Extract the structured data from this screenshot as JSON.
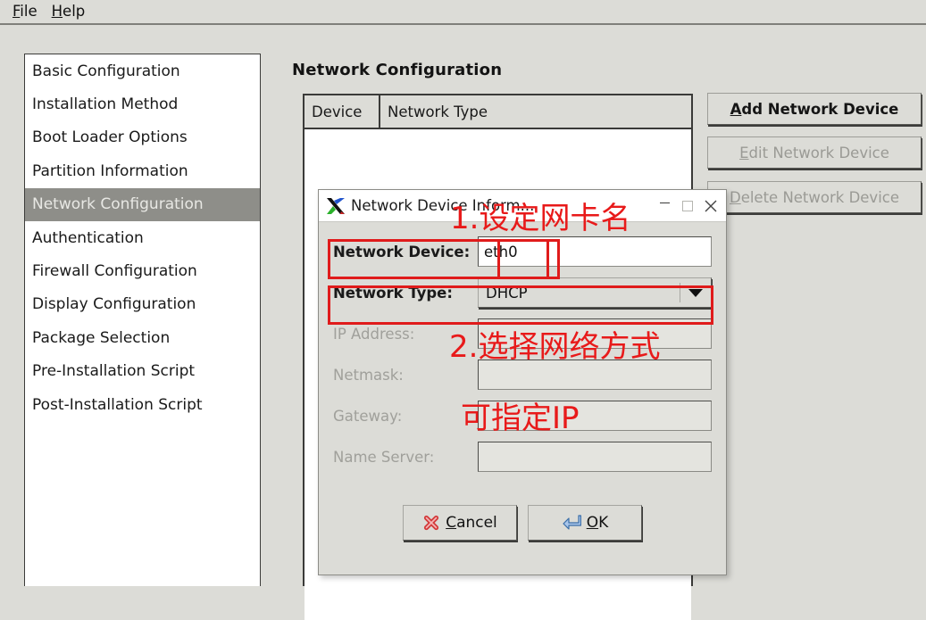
{
  "menubar": {
    "items": [
      {
        "name": "file",
        "accel": "F",
        "rest": "ile"
      },
      {
        "name": "help",
        "accel": "H",
        "rest": "elp"
      }
    ]
  },
  "sidebar": {
    "items": [
      {
        "label": "Basic Configuration",
        "selected": false
      },
      {
        "label": "Installation Method",
        "selected": false
      },
      {
        "label": "Boot Loader Options",
        "selected": false
      },
      {
        "label": "Partition Information",
        "selected": false
      },
      {
        "label": "Network Configuration",
        "selected": true
      },
      {
        "label": "Authentication",
        "selected": false
      },
      {
        "label": "Firewall Configuration",
        "selected": false
      },
      {
        "label": "Display Configuration",
        "selected": false
      },
      {
        "label": "Package Selection",
        "selected": false
      },
      {
        "label": "Pre-Installation Script",
        "selected": false
      },
      {
        "label": "Post-Installation Script",
        "selected": false
      }
    ]
  },
  "main": {
    "title": "Network Configuration",
    "table": {
      "columns": [
        "Device",
        "Network Type"
      ],
      "rows": []
    },
    "buttons": [
      {
        "key": "add",
        "accel": "A",
        "rest": "dd Network Device",
        "enabled": true
      },
      {
        "key": "edit",
        "accel": "E",
        "rest": "dit Network Device",
        "enabled": false
      },
      {
        "key": "delete",
        "accel": "D",
        "rest": "elete Network Device",
        "enabled": false
      }
    ]
  },
  "dialog": {
    "title": "Network Device Inform...",
    "window_controls": {
      "minimize": "minimize-button",
      "maximize": "maximize-button",
      "close": "close-button"
    },
    "fields": [
      {
        "key": "network_device",
        "label": "Network Device:",
        "value": "eth0",
        "type": "text",
        "enabled": true
      },
      {
        "key": "network_type",
        "label": "Network Type:",
        "value": "DHCP",
        "type": "combo",
        "enabled": true
      },
      {
        "key": "ip_address",
        "label": "IP Address:",
        "value": "",
        "type": "text",
        "enabled": false
      },
      {
        "key": "netmask",
        "label": "Netmask:",
        "value": "",
        "type": "text",
        "enabled": false
      },
      {
        "key": "gateway",
        "label": "Gateway:",
        "value": "",
        "type": "text",
        "enabled": false
      },
      {
        "key": "name_server",
        "label": "Name Server:",
        "value": "",
        "type": "text",
        "enabled": false
      }
    ],
    "buttons": {
      "cancel": {
        "accel": "C",
        "rest": "ancel",
        "icon": "red-x-icon"
      },
      "ok": {
        "accel": "O",
        "rest": "K",
        "icon": "blue-enter-arrow-icon"
      }
    }
  },
  "annotations": {
    "color": "#e81a1a",
    "texts": [
      {
        "key": "step1",
        "text": "1.设定网卡名"
      },
      {
        "key": "step2",
        "text": "2.选择网络方式"
      },
      {
        "key": "step3",
        "text": "可指定IP"
      }
    ],
    "boxes": [
      {
        "key": "network-device-highlight"
      },
      {
        "key": "network-type-highlight"
      }
    ]
  }
}
